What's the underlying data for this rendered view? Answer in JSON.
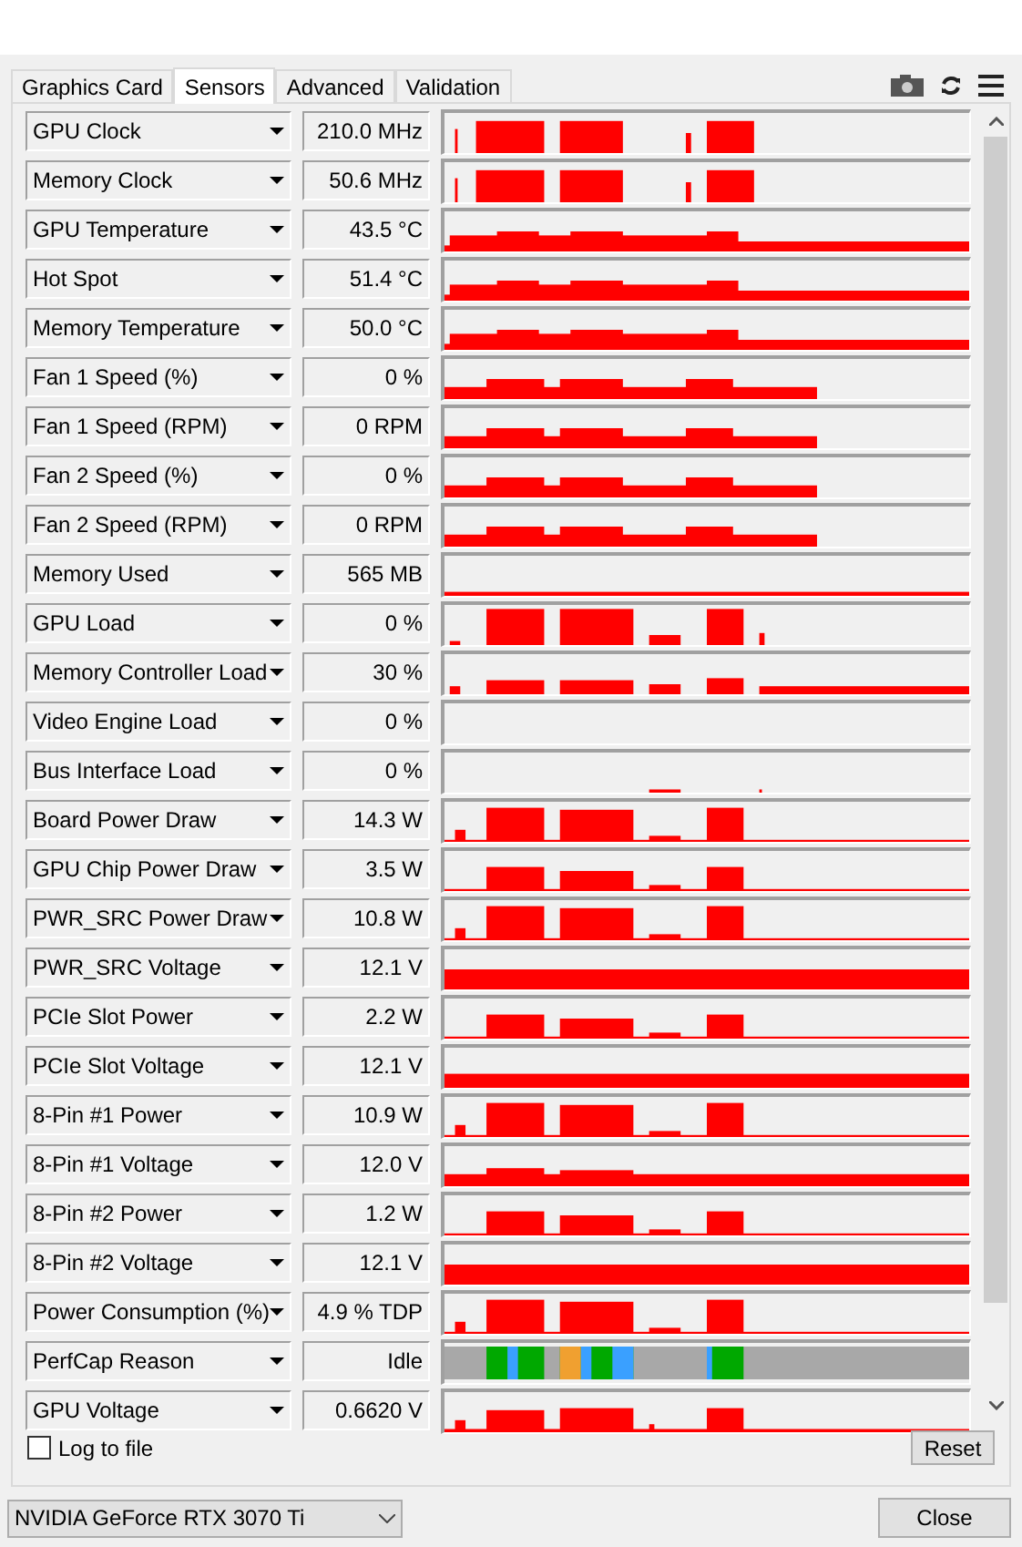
{
  "tabs": [
    {
      "label": "Graphics Card",
      "selected": false
    },
    {
      "label": "Sensors",
      "selected": true
    },
    {
      "label": "Advanced",
      "selected": false
    },
    {
      "label": "Validation",
      "selected": false
    }
  ],
  "sensors": [
    {
      "name": "GPU Clock",
      "value": "210.0 MHz"
    },
    {
      "name": "Memory Clock",
      "value": "50.6 MHz"
    },
    {
      "name": "GPU Temperature",
      "value": "43.5 °C"
    },
    {
      "name": "Hot Spot",
      "value": "51.4 °C"
    },
    {
      "name": "Memory Temperature",
      "value": "50.0 °C"
    },
    {
      "name": "Fan 1 Speed (%)",
      "value": "0 %"
    },
    {
      "name": "Fan 1 Speed (RPM)",
      "value": "0 RPM"
    },
    {
      "name": "Fan 2 Speed (%)",
      "value": "0 %"
    },
    {
      "name": "Fan 2 Speed (RPM)",
      "value": "0 RPM"
    },
    {
      "name": "Memory Used",
      "value": "565 MB"
    },
    {
      "name": "GPU Load",
      "value": "0 %"
    },
    {
      "name": "Memory Controller Load",
      "value": "30 %"
    },
    {
      "name": "Video Engine Load",
      "value": "0 %"
    },
    {
      "name": "Bus Interface Load",
      "value": "0 %"
    },
    {
      "name": "Board Power Draw",
      "value": "14.3 W"
    },
    {
      "name": "GPU Chip Power Draw",
      "value": "3.5 W"
    },
    {
      "name": "PWR_SRC Power Draw",
      "value": "10.8 W"
    },
    {
      "name": "PWR_SRC Voltage",
      "value": "12.1 V"
    },
    {
      "name": "PCIe Slot Power",
      "value": "2.2 W"
    },
    {
      "name": "PCIe Slot Voltage",
      "value": "12.1 V"
    },
    {
      "name": "8-Pin #1 Power",
      "value": "10.9 W"
    },
    {
      "name": "8-Pin #1 Voltage",
      "value": "12.0 V"
    },
    {
      "name": "8-Pin #2 Power",
      "value": "1.2 W"
    },
    {
      "name": "8-Pin #2 Voltage",
      "value": "12.1 V"
    },
    {
      "name": "Power Consumption (%)",
      "value": "4.9 % TDP"
    },
    {
      "name": "PerfCap Reason",
      "value": "Idle"
    },
    {
      "name": "GPU Voltage",
      "value": "0.6620 V"
    }
  ],
  "log_to_file": {
    "label": "Log to file",
    "checked": false
  },
  "reset_button": "Reset",
  "gpu_select": {
    "value": "NVIDIA GeForce RTX 3070 Ti"
  },
  "close_button": "Close"
}
